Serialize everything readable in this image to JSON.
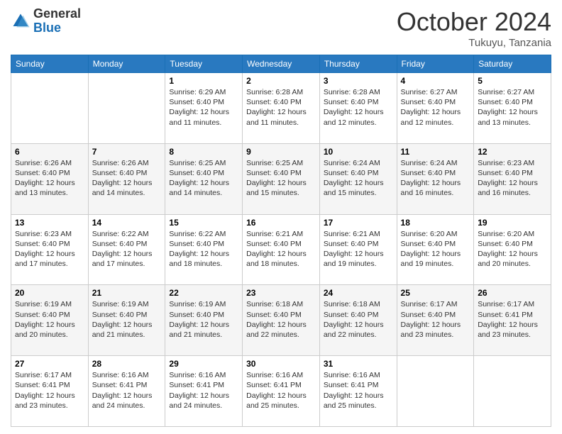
{
  "header": {
    "logo_general": "General",
    "logo_blue": "Blue",
    "month_title": "October 2024",
    "location": "Tukuyu, Tanzania"
  },
  "days_of_week": [
    "Sunday",
    "Monday",
    "Tuesday",
    "Wednesday",
    "Thursday",
    "Friday",
    "Saturday"
  ],
  "weeks": [
    [
      null,
      null,
      {
        "day": "1",
        "sunrise": "Sunrise: 6:29 AM",
        "sunset": "Sunset: 6:40 PM",
        "daylight": "Daylight: 12 hours and 11 minutes."
      },
      {
        "day": "2",
        "sunrise": "Sunrise: 6:28 AM",
        "sunset": "Sunset: 6:40 PM",
        "daylight": "Daylight: 12 hours and 11 minutes."
      },
      {
        "day": "3",
        "sunrise": "Sunrise: 6:28 AM",
        "sunset": "Sunset: 6:40 PM",
        "daylight": "Daylight: 12 hours and 12 minutes."
      },
      {
        "day": "4",
        "sunrise": "Sunrise: 6:27 AM",
        "sunset": "Sunset: 6:40 PM",
        "daylight": "Daylight: 12 hours and 12 minutes."
      },
      {
        "day": "5",
        "sunrise": "Sunrise: 6:27 AM",
        "sunset": "Sunset: 6:40 PM",
        "daylight": "Daylight: 12 hours and 13 minutes."
      }
    ],
    [
      {
        "day": "6",
        "sunrise": "Sunrise: 6:26 AM",
        "sunset": "Sunset: 6:40 PM",
        "daylight": "Daylight: 12 hours and 13 minutes."
      },
      {
        "day": "7",
        "sunrise": "Sunrise: 6:26 AM",
        "sunset": "Sunset: 6:40 PM",
        "daylight": "Daylight: 12 hours and 14 minutes."
      },
      {
        "day": "8",
        "sunrise": "Sunrise: 6:25 AM",
        "sunset": "Sunset: 6:40 PM",
        "daylight": "Daylight: 12 hours and 14 minutes."
      },
      {
        "day": "9",
        "sunrise": "Sunrise: 6:25 AM",
        "sunset": "Sunset: 6:40 PM",
        "daylight": "Daylight: 12 hours and 15 minutes."
      },
      {
        "day": "10",
        "sunrise": "Sunrise: 6:24 AM",
        "sunset": "Sunset: 6:40 PM",
        "daylight": "Daylight: 12 hours and 15 minutes."
      },
      {
        "day": "11",
        "sunrise": "Sunrise: 6:24 AM",
        "sunset": "Sunset: 6:40 PM",
        "daylight": "Daylight: 12 hours and 16 minutes."
      },
      {
        "day": "12",
        "sunrise": "Sunrise: 6:23 AM",
        "sunset": "Sunset: 6:40 PM",
        "daylight": "Daylight: 12 hours and 16 minutes."
      }
    ],
    [
      {
        "day": "13",
        "sunrise": "Sunrise: 6:23 AM",
        "sunset": "Sunset: 6:40 PM",
        "daylight": "Daylight: 12 hours and 17 minutes."
      },
      {
        "day": "14",
        "sunrise": "Sunrise: 6:22 AM",
        "sunset": "Sunset: 6:40 PM",
        "daylight": "Daylight: 12 hours and 17 minutes."
      },
      {
        "day": "15",
        "sunrise": "Sunrise: 6:22 AM",
        "sunset": "Sunset: 6:40 PM",
        "daylight": "Daylight: 12 hours and 18 minutes."
      },
      {
        "day": "16",
        "sunrise": "Sunrise: 6:21 AM",
        "sunset": "Sunset: 6:40 PM",
        "daylight": "Daylight: 12 hours and 18 minutes."
      },
      {
        "day": "17",
        "sunrise": "Sunrise: 6:21 AM",
        "sunset": "Sunset: 6:40 PM",
        "daylight": "Daylight: 12 hours and 19 minutes."
      },
      {
        "day": "18",
        "sunrise": "Sunrise: 6:20 AM",
        "sunset": "Sunset: 6:40 PM",
        "daylight": "Daylight: 12 hours and 19 minutes."
      },
      {
        "day": "19",
        "sunrise": "Sunrise: 6:20 AM",
        "sunset": "Sunset: 6:40 PM",
        "daylight": "Daylight: 12 hours and 20 minutes."
      }
    ],
    [
      {
        "day": "20",
        "sunrise": "Sunrise: 6:19 AM",
        "sunset": "Sunset: 6:40 PM",
        "daylight": "Daylight: 12 hours and 20 minutes."
      },
      {
        "day": "21",
        "sunrise": "Sunrise: 6:19 AM",
        "sunset": "Sunset: 6:40 PM",
        "daylight": "Daylight: 12 hours and 21 minutes."
      },
      {
        "day": "22",
        "sunrise": "Sunrise: 6:19 AM",
        "sunset": "Sunset: 6:40 PM",
        "daylight": "Daylight: 12 hours and 21 minutes."
      },
      {
        "day": "23",
        "sunrise": "Sunrise: 6:18 AM",
        "sunset": "Sunset: 6:40 PM",
        "daylight": "Daylight: 12 hours and 22 minutes."
      },
      {
        "day": "24",
        "sunrise": "Sunrise: 6:18 AM",
        "sunset": "Sunset: 6:40 PM",
        "daylight": "Daylight: 12 hours and 22 minutes."
      },
      {
        "day": "25",
        "sunrise": "Sunrise: 6:17 AM",
        "sunset": "Sunset: 6:40 PM",
        "daylight": "Daylight: 12 hours and 23 minutes."
      },
      {
        "day": "26",
        "sunrise": "Sunrise: 6:17 AM",
        "sunset": "Sunset: 6:41 PM",
        "daylight": "Daylight: 12 hours and 23 minutes."
      }
    ],
    [
      {
        "day": "27",
        "sunrise": "Sunrise: 6:17 AM",
        "sunset": "Sunset: 6:41 PM",
        "daylight": "Daylight: 12 hours and 23 minutes."
      },
      {
        "day": "28",
        "sunrise": "Sunrise: 6:16 AM",
        "sunset": "Sunset: 6:41 PM",
        "daylight": "Daylight: 12 hours and 24 minutes."
      },
      {
        "day": "29",
        "sunrise": "Sunrise: 6:16 AM",
        "sunset": "Sunset: 6:41 PM",
        "daylight": "Daylight: 12 hours and 24 minutes."
      },
      {
        "day": "30",
        "sunrise": "Sunrise: 6:16 AM",
        "sunset": "Sunset: 6:41 PM",
        "daylight": "Daylight: 12 hours and 25 minutes."
      },
      {
        "day": "31",
        "sunrise": "Sunrise: 6:16 AM",
        "sunset": "Sunset: 6:41 PM",
        "daylight": "Daylight: 12 hours and 25 minutes."
      },
      null,
      null
    ]
  ]
}
